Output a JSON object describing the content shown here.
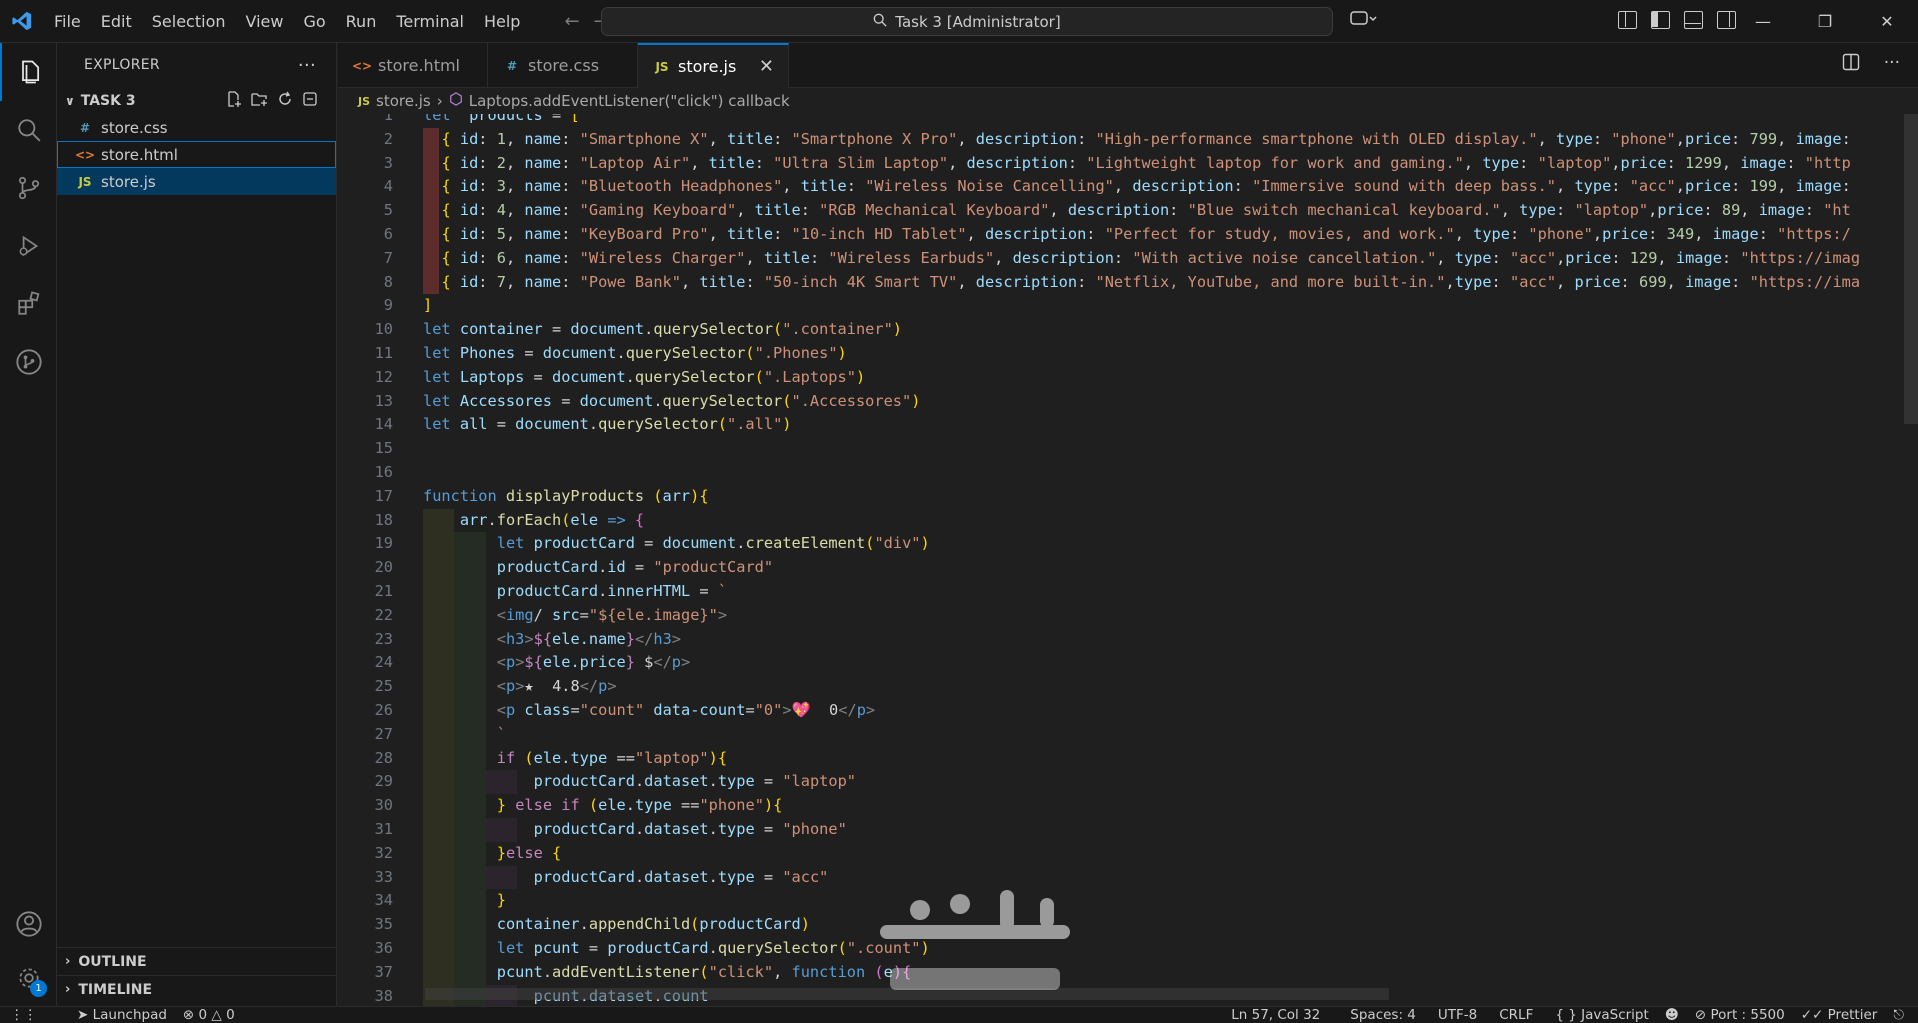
{
  "window": {
    "command_center": "Task 3 [Administrator]",
    "menu": [
      "File",
      "Edit",
      "Selection",
      "View",
      "Go",
      "Run",
      "Terminal",
      "Help"
    ]
  },
  "explorer": {
    "title": "EXPLORER",
    "folder": "TASK 3",
    "files": [
      {
        "name": "store.css",
        "kind": "css"
      },
      {
        "name": "store.html",
        "kind": "html"
      },
      {
        "name": "store.js",
        "kind": "js"
      }
    ],
    "sections": [
      "OUTLINE",
      "TIMELINE"
    ]
  },
  "tabs": [
    {
      "label": "store.html",
      "kind": "html",
      "active": false
    },
    {
      "label": "store.css",
      "kind": "css",
      "active": false
    },
    {
      "label": "store.js",
      "kind": "js",
      "active": true
    }
  ],
  "breadcrumb": {
    "file": "store.js",
    "symbol": "Laptops.addEventListener(\"click\") callback"
  },
  "accounts_badge": "1",
  "editor": {
    "first_line": 1,
    "lines": [
      "let  products = [",
      "  { id: 1, name: \"Smartphone X\", title: \"Smartphone X Pro\", description: \"High-performance smartphone with OLED display.\", type: \"phone\",price: 799, image: ",
      "  { id: 2, name: \"Laptop Air\", title: \"Ultra Slim Laptop\", description: \"Lightweight laptop for work and gaming.\", type: \"laptop\",price: 1299, image: \"http",
      "  { id: 3, name: \"Bluetooth Headphones\", title: \"Wireless Noise Cancelling\", description: \"Immersive sound with deep bass.\", type: \"acc\",price: 199, image: ",
      "  { id: 4, name: \"Gaming Keyboard\", title: \"RGB Mechanical Keyboard\", description: \"Blue switch mechanical keyboard.\", type: \"laptop\",price: 89, image: \"ht",
      "  { id: 5, name: \"KeyBoard Pro\", title: \"10-inch HD Tablet\", description: \"Perfect for study, movies, and work.\", type: \"phone\",price: 349, image: \"https:/",
      "  { id: 6, name: \"Wireless Charger\", title: \"Wireless Earbuds\", description: \"With active noise cancellation.\", type: \"acc\",price: 129, image: \"https://imag",
      "  { id: 7, name: \"Powe Bank\", title: \"50-inch 4K Smart TV\", description: \"Netflix, YouTube, and more built-in.\",type: \"acc\", price: 699, image: \"https://ima",
      "]",
      "let container = document.querySelector(\".container\")",
      "let Phones = document.querySelector(\".Phones\")",
      "let Laptops = document.querySelector(\".Laptops\")",
      "let Accessores = document.querySelector(\".Accessores\")",
      "let all = document.querySelector(\".all\")",
      "",
      "",
      "function displayProducts (arr){",
      "    arr.forEach(ele => {",
      "        let productCard = document.createElement(\"div\")",
      "        productCard.id = \"productCard\"",
      "        productCard.innerHTML = `",
      "        <img/ src=\"${ele.image}\">",
      "        <h3>${ele.name}</h3>",
      "        <p>${ele.price} $</p>",
      "        <p>★  4.8</p>",
      "        <p class=\"count\" data-count=\"0\">💖  0</p>",
      "        `",
      "        if (ele.type ==\"laptop\"){",
      "            productCard.dataset.type = \"laptop\"",
      "        } else if (ele.type ==\"phone\"){",
      "            productCard.dataset.type = \"phone\"",
      "        }else {",
      "            productCard.dataset.type = \"acc\"",
      "        }",
      "        container.appendChild(productCard)",
      "        let pcunt = productCard.querySelector(\".count\")",
      "        pcunt.addEventListener(\"click\", function (e){",
      "            pcunt.dataset.count"
    ]
  },
  "status": {
    "launchpad": "Launchpad",
    "errors": "0",
    "warnings": "0",
    "position": "Ln 57, Col 32",
    "spaces": "Spaces: 4",
    "encoding": "UTF-8",
    "eol": "CRLF",
    "language": "JavaScript",
    "port": "Port : 5500",
    "formatter": "Prettier"
  }
}
